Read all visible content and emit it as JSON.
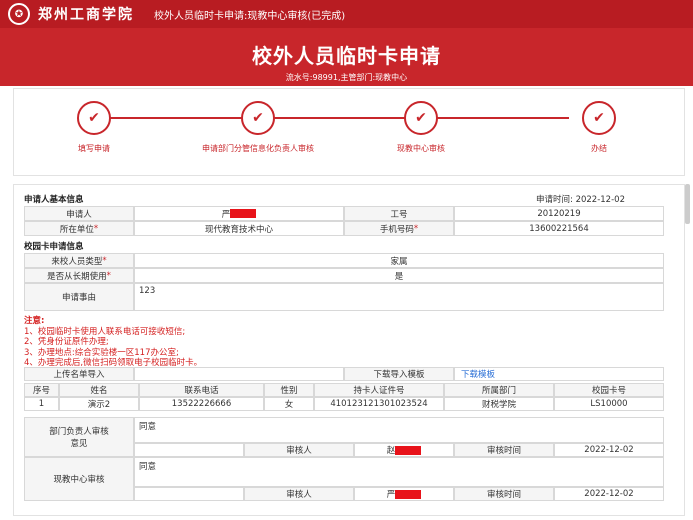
{
  "header": {
    "brand": "郑州工商学院",
    "page_title": "校外人员临时卡申请:现教中心审核(已完成)",
    "banner_title": "校外人员临时卡申请",
    "banner_sub": "流水号:98991,主管部门:现教中心"
  },
  "steps": [
    {
      "label": "填写申请"
    },
    {
      "label": "申请部门分管信息化负责人审核"
    },
    {
      "label": "现教中心审核"
    },
    {
      "label": "办结"
    }
  ],
  "basic": {
    "section": "申请人基本信息",
    "apply_time_label": "申请时间:",
    "apply_time": "2022-12-02",
    "applicant_label": "申请人",
    "applicant_value": "严",
    "emp_no_label": "工号",
    "emp_no": "20120219",
    "unit_label": "所在单位",
    "unit_value": "现代教育技术中心",
    "phone_label": "手机号码",
    "phone": "13600221564"
  },
  "card": {
    "section": "校园卡申请信息",
    "type_label": "来校人员类型",
    "type_value": "家属",
    "longterm_label": "是否从长期使用",
    "longterm_value": "是",
    "reason_label": "申请事由",
    "reason_value": "123"
  },
  "notes": {
    "title": "注意:",
    "items": [
      "1、校园临时卡使用人联系电话可接收短信;",
      "2、凭身份证原件办理;",
      "3、办理地点:综合实验楼一区117办公室;",
      "4、办理完成后,微信扫码领取电子校园临时卡。"
    ]
  },
  "upload": {
    "label": "上传名单导入",
    "download_label": "下载导入模板",
    "download_link": "下载模板"
  },
  "table": {
    "columns": [
      "序号",
      "姓名",
      "联系电话",
      "性别",
      "持卡人证件号",
      "所属部门",
      "校园卡号"
    ],
    "rows": [
      [
        "1",
        "演示2",
        "13522226666",
        "女",
        "410123121301023524",
        "财税学院",
        "LS10000"
      ]
    ]
  },
  "dept_review": {
    "label": "部门负责人审核意见",
    "opinion": "同意",
    "reviewer_label": "审核人",
    "reviewer": "赵",
    "time_label": "审核时间",
    "time": "2022-12-02"
  },
  "center_review": {
    "label": "现教中心审核",
    "opinion": "同意",
    "reviewer_label": "审核人",
    "reviewer": "严",
    "time_label": "审核时间",
    "time": "2022-12-02"
  },
  "colors": {
    "brand": "#c8262b",
    "redaction": "#e8131a"
  },
  "icons": {
    "step": "check-icon",
    "logo": "school-seal-icon"
  }
}
